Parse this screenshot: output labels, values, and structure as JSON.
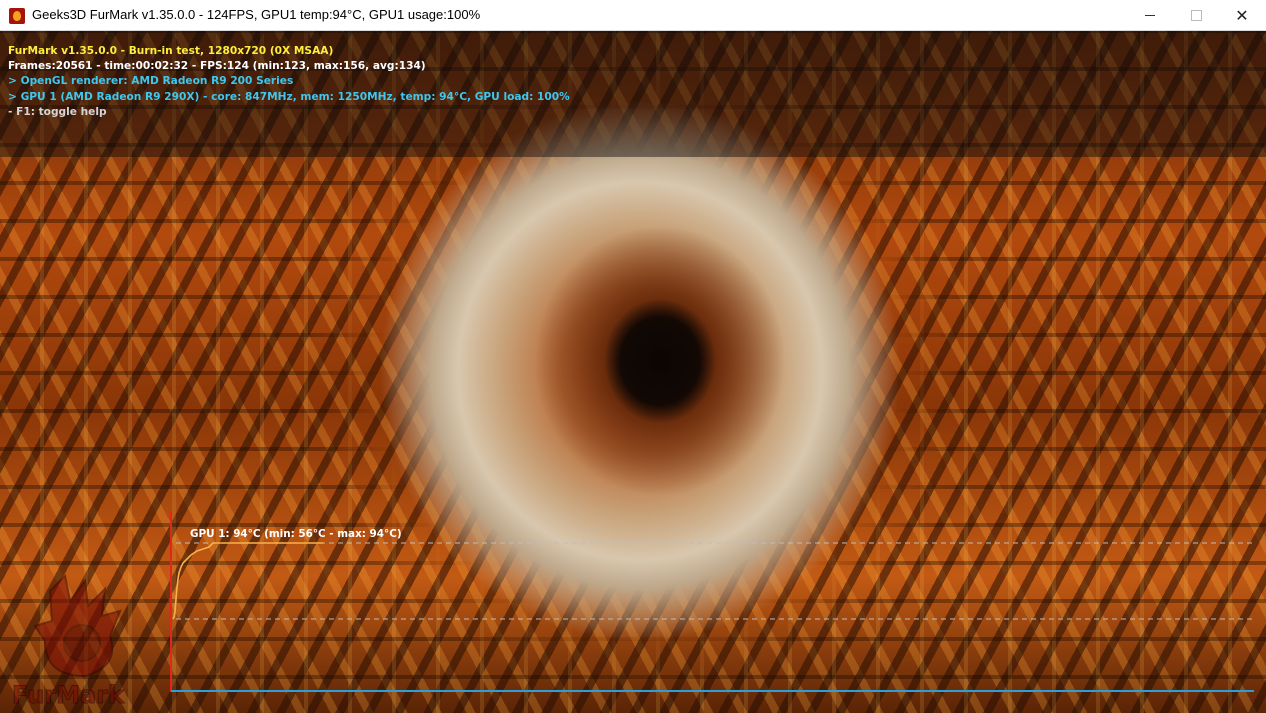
{
  "window": {
    "title": "Geeks3D FurMark v1.35.0.0 - 124FPS, GPU1 temp:94°C, GPU1 usage:100%",
    "app_icon": "furmark-flame-icon",
    "controls": {
      "minimize": "minimize-icon",
      "maximize": "maximize-icon",
      "close": "close-icon"
    }
  },
  "hud": {
    "line1": "FurMark v1.35.0.0 - Burn-in test, 1280x720 (0X MSAA)",
    "line2": "Frames:20561 - time:00:02:32 - FPS:124 (min:123, max:156, avg:134)",
    "line3": "> OpenGL renderer: AMD Radeon R9 200 Series",
    "line4": "> GPU 1 (AMD Radeon R9 290X) - core: 847MHz, mem: 1250MHz, temp: 94°C, GPU load: 100%",
    "line5": "- F1: toggle help"
  },
  "temp_graph": {
    "label": "GPU 1: 94°C (min: 56°C - max: 94°C)",
    "current_c": 94,
    "min_c": 56,
    "max_c": 94,
    "series": [
      {
        "t": 0,
        "c": 56
      },
      {
        "t": 1,
        "c": 57
      },
      {
        "t": 2,
        "c": 60
      },
      {
        "t": 3,
        "c": 66
      },
      {
        "t": 4,
        "c": 72
      },
      {
        "t": 5,
        "c": 76
      },
      {
        "t": 6,
        "c": 79
      },
      {
        "t": 8,
        "c": 82
      },
      {
        "t": 10,
        "c": 84
      },
      {
        "t": 14,
        "c": 86
      },
      {
        "t": 18,
        "c": 88
      },
      {
        "t": 24,
        "c": 90
      },
      {
        "t": 30,
        "c": 91
      },
      {
        "t": 36,
        "c": 92
      },
      {
        "t": 40,
        "c": 94
      },
      {
        "t": 60,
        "c": 94
      },
      {
        "t": 100,
        "c": 94
      },
      {
        "t": 150,
        "c": 94
      }
    ],
    "colors": {
      "line": "#f7b24a",
      "axis_x": "#2aa0d6",
      "axis_y": "#e3261b",
      "guide": "#bdbdbd"
    }
  },
  "colors": {
    "hud_yellow": "#ffee3a",
    "hud_cyan": "#3ec8f0",
    "hud_white": "#ffffff"
  },
  "watermark": {
    "name": "furmark-logo",
    "text": "FurMark"
  }
}
